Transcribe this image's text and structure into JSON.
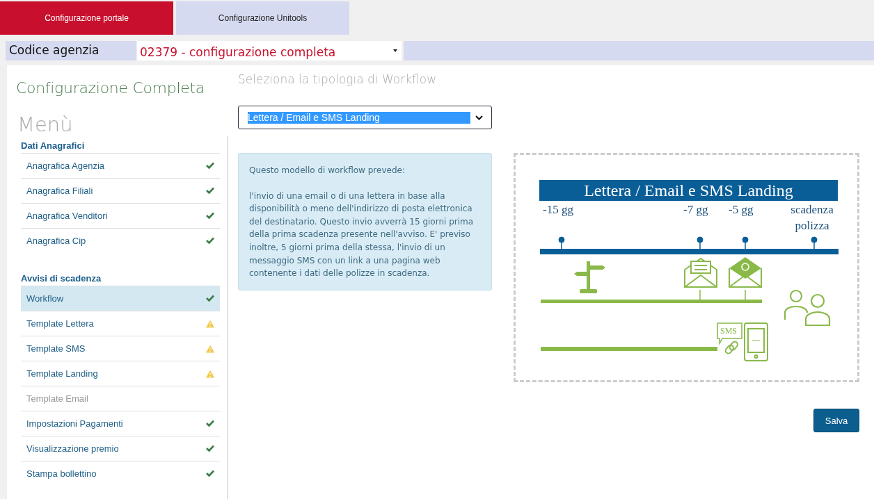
{
  "tabs": [
    {
      "label": "Configurazione portale",
      "selected": true
    },
    {
      "label": "Configurazione Unitools",
      "selected": false
    }
  ],
  "agency": {
    "label": "Codice agenzia",
    "value": "02379 - configurazione completa"
  },
  "sidebar": {
    "title": "Configurazione Completa",
    "menu_title": "Menù",
    "sections": [
      {
        "heading": "Dati Anagrafici",
        "items": [
          {
            "label": "Anagrafica Agenzia",
            "kind": "ok",
            "selected": false,
            "disabled": false
          },
          {
            "label": "Anagrafica Filiali",
            "kind": "ok",
            "selected": false,
            "disabled": false
          },
          {
            "label": "Anagrafica Venditori",
            "kind": "ok",
            "selected": false,
            "disabled": false
          },
          {
            "label": "Anagrafica Cip",
            "kind": "ok",
            "selected": false,
            "disabled": false
          }
        ]
      },
      {
        "heading": "Avvisi di scadenza",
        "items": [
          {
            "label": "Workflow",
            "kind": "ok",
            "selected": true,
            "disabled": false
          },
          {
            "label": "Template Lettera",
            "kind": "warning",
            "selected": false,
            "disabled": false
          },
          {
            "label": "Template SMS",
            "kind": "warning",
            "selected": false,
            "disabled": false
          },
          {
            "label": "Template Landing",
            "kind": "warning",
            "selected": false,
            "disabled": false
          },
          {
            "label": "Template Email",
            "kind": "plain",
            "selected": false,
            "disabled": true
          },
          {
            "label": "Impostazioni Pagamenti",
            "kind": "ok",
            "selected": false,
            "disabled": false
          },
          {
            "label": "Visualizzazione premio",
            "kind": "ok",
            "selected": false,
            "disabled": false
          },
          {
            "label": "Stampa bollettino",
            "kind": "ok",
            "selected": false,
            "disabled": false
          }
        ]
      }
    ]
  },
  "workflow": {
    "heading": "Seleziona la tipologia di Workflow",
    "select_value": "Lettera / Email e SMS Landing",
    "info": {
      "intro": "Questo modello di workflow prevede:",
      "body": "l'invio di una email o di una lettera in base alla disponibilità o meno dell'indirizzo di posta elettronica del destinatario. Questo invio avverrà 15 giorni prima della prima scadenza presente nell'avviso. E' previso inoltre, 5 giorni prima della stessa, l'invio di un messaggio SMS con un link a una pagina web contenente i dati delle polizze in scadenza."
    },
    "diagram": {
      "title": "Lettera / Email e SMS Landing",
      "milestones": [
        "-15 gg",
        "-7 gg",
        "-5 gg",
        "scadenza polizza"
      ],
      "sms_label": "SMS"
    }
  },
  "save_button": "Salva"
}
